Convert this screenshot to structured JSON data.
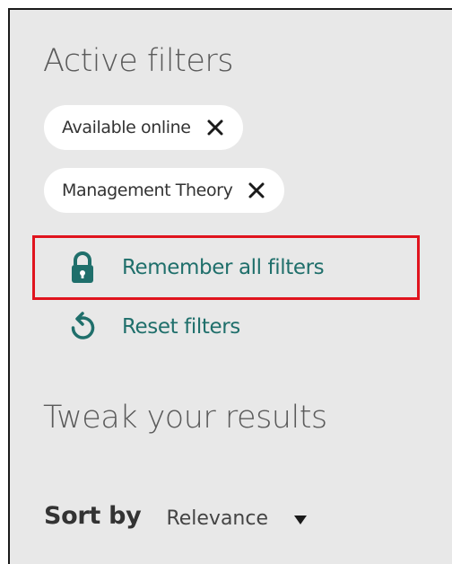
{
  "active_filters": {
    "title": "Active filters",
    "chips": [
      {
        "label": "Available online"
      },
      {
        "label": "Management Theory"
      }
    ],
    "remember_label": "Remember all filters",
    "reset_label": "Reset filters"
  },
  "tweak": {
    "title": "Tweak your results",
    "sort_label": "Sort by",
    "sort_value": "Relevance"
  },
  "colors": {
    "accent": "#1f6f6b",
    "highlight": "#e0141e",
    "panel_bg": "#e8e8e8",
    "chip_bg": "#ffffff"
  },
  "icons": {
    "remove": "close-icon",
    "remember": "lock-icon",
    "reset": "reset-icon",
    "dropdown": "caret-down-icon"
  }
}
